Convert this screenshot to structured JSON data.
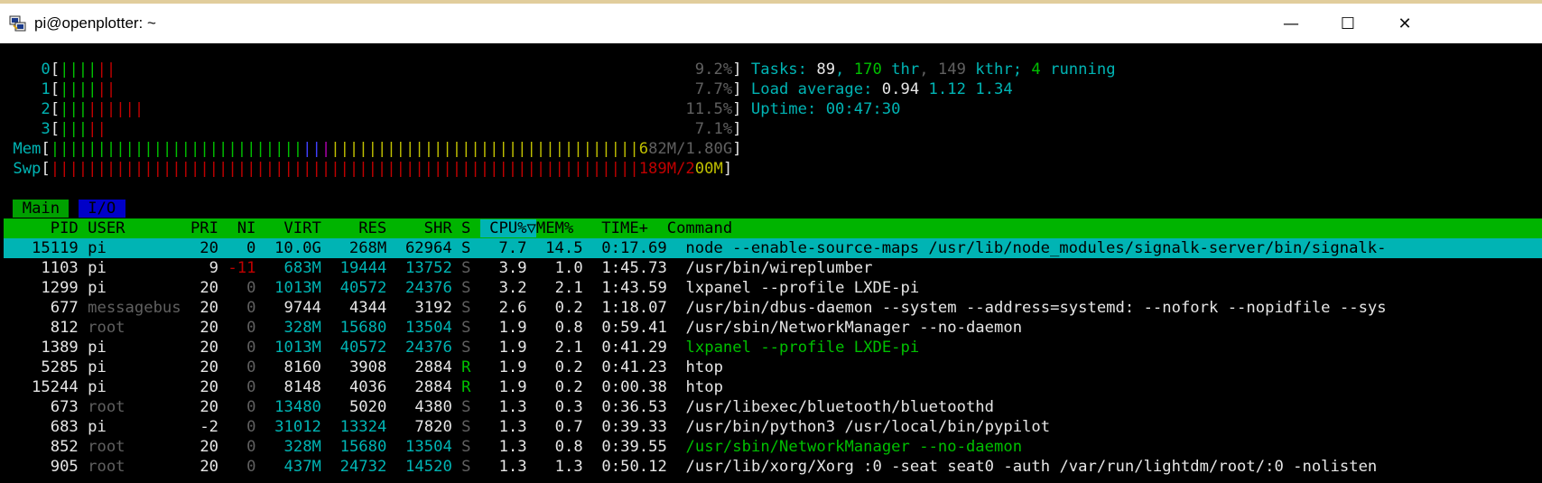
{
  "window": {
    "title": "pi@openplotter: ~",
    "minimize_label": "—",
    "maximize_label": "☐",
    "close_label": "✕",
    "app_icon": "putty-icon"
  },
  "meters": {
    "cpus": [
      {
        "label": "0",
        "bars": "||||||",
        "value": "9.2%"
      },
      {
        "label": "1",
        "bars": "||||||",
        "value": "7.7%"
      },
      {
        "label": "2",
        "bars": "|||||||||",
        "value": "11.5%"
      },
      {
        "label": "3",
        "bars": "|||||",
        "value": "7.1%"
      }
    ],
    "mem": {
      "label": "Mem",
      "value": "682M/1.80G"
    },
    "swp": {
      "label": "Swp",
      "value": "189M/200M"
    }
  },
  "summary": {
    "tasks_label": "Tasks: ",
    "tasks": "89",
    "thr": "170",
    "thr_label": " thr",
    "kthr": "149",
    "kthr_label": " kthr",
    "running": "4",
    "running_label": " running",
    "load_label": "Load average: ",
    "load1": "0.94",
    "load5": "1.12",
    "load15": "1.34",
    "uptime_label": "Uptime: ",
    "uptime": "00:47:30"
  },
  "tabs": [
    "Main",
    "I/O"
  ],
  "columns": [
    "PID",
    "USER",
    "PRI",
    "NI",
    "VIRT",
    "RES",
    "SHR",
    "S",
    "CPU%",
    "MEM%",
    "TIME+",
    "Command"
  ],
  "sort_indicator": "▽",
  "processes": [
    {
      "pid": "15119",
      "user": "pi",
      "pri": "20",
      "ni": "0",
      "virt": "10.0G",
      "res": "268M",
      "shr": "62964",
      "s": "S",
      "cpu": "7.7",
      "mem": "14.5",
      "time": "0:17.69",
      "cmd": "node --enable-source-maps /usr/lib/node_modules/signalk-server/bin/signalk-"
    },
    {
      "pid": "1103",
      "user": "pi",
      "pri": "9",
      "ni": "-11",
      "virt": "683M",
      "res": "19444",
      "shr": "13752",
      "s": "S",
      "cpu": "3.9",
      "mem": "1.0",
      "time": "1:45.73",
      "cmd": "/usr/bin/wireplumber"
    },
    {
      "pid": "1299",
      "user": "pi",
      "pri": "20",
      "ni": "0",
      "virt": "1013M",
      "res": "40572",
      "shr": "24376",
      "s": "S",
      "cpu": "3.2",
      "mem": "2.1",
      "time": "1:43.59",
      "cmd": "lxpanel --profile LXDE-pi"
    },
    {
      "pid": "677",
      "user": "messagebus",
      "pri": "20",
      "ni": "0",
      "virt": "9744",
      "res": "4344",
      "shr": "3192",
      "s": "S",
      "cpu": "2.6",
      "mem": "0.2",
      "time": "1:18.07",
      "cmd": "/usr/bin/dbus-daemon --system --address=systemd: --nofork --nopidfile --sys"
    },
    {
      "pid": "812",
      "user": "root",
      "pri": "20",
      "ni": "0",
      "virt": "328M",
      "res": "15680",
      "shr": "13504",
      "s": "S",
      "cpu": "1.9",
      "mem": "0.8",
      "time": "0:59.41",
      "cmd": "/usr/sbin/NetworkManager --no-daemon"
    },
    {
      "pid": "1389",
      "user": "pi",
      "pri": "20",
      "ni": "0",
      "virt": "1013M",
      "res": "40572",
      "shr": "24376",
      "s": "S",
      "cpu": "1.9",
      "mem": "2.1",
      "time": "0:41.29",
      "cmd": "lxpanel --profile LXDE-pi"
    },
    {
      "pid": "5285",
      "user": "pi",
      "pri": "20",
      "ni": "0",
      "virt": "8160",
      "res": "3908",
      "shr": "2884",
      "s": "R",
      "cpu": "1.9",
      "mem": "0.2",
      "time": "0:41.23",
      "cmd": "htop"
    },
    {
      "pid": "15244",
      "user": "pi",
      "pri": "20",
      "ni": "0",
      "virt": "8148",
      "res": "4036",
      "shr": "2884",
      "s": "R",
      "cpu": "1.9",
      "mem": "0.2",
      "time": "0:00.38",
      "cmd": "htop"
    },
    {
      "pid": "673",
      "user": "root",
      "pri": "20",
      "ni": "0",
      "virt": "13480",
      "res": "5020",
      "shr": "4380",
      "s": "S",
      "cpu": "1.3",
      "mem": "0.3",
      "time": "0:36.53",
      "cmd": "/usr/libexec/bluetooth/bluetoothd"
    },
    {
      "pid": "683",
      "user": "pi",
      "pri": "-2",
      "ni": "0",
      "virt": "31012",
      "res": "13324",
      "shr": "7820",
      "s": "S",
      "cpu": "1.3",
      "mem": "0.7",
      "time": "0:39.33",
      "cmd": "/usr/bin/python3 /usr/local/bin/pypilot"
    },
    {
      "pid": "852",
      "user": "root",
      "pri": "20",
      "ni": "0",
      "virt": "328M",
      "res": "15680",
      "shr": "13504",
      "s": "S",
      "cpu": "1.3",
      "mem": "0.8",
      "time": "0:39.55",
      "cmd": "/usr/sbin/NetworkManager --no-daemon"
    },
    {
      "pid": "905",
      "user": "root",
      "pri": "20",
      "ni": "0",
      "virt": "437M",
      "res": "24732",
      "shr": "14520",
      "s": "S",
      "cpu": "1.3",
      "mem": "1.3",
      "time": "0:50.12",
      "cmd": "/usr/lib/xorg/Xorg :0 -seat seat0 -auth /var/run/lightdm/root/:0 -nolisten"
    }
  ],
  "colors": {
    "green": "#00c000",
    "cyan": "#00b4b4",
    "red": "#c00000",
    "blue_tab": "#0000c8",
    "header_green": "#00b400",
    "thread_green": "#00c000"
  }
}
